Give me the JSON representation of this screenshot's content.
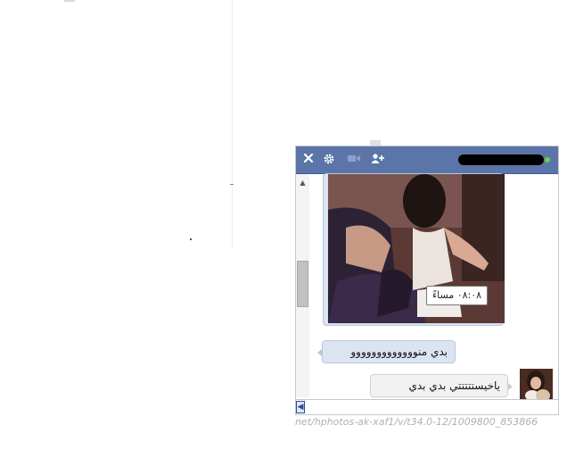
{
  "chat": {
    "icons": {
      "close": "close-icon",
      "settings": "gear-icon",
      "video": "video-camera-icon",
      "add_friend": "add-friend-icon"
    },
    "photo_timestamp": "٠٨:٠٨ مساءً",
    "messages": [
      {
        "text": "بدي منووووووووووووو",
        "side": "in"
      },
      {
        "text": "ياخيستتتتتي بدي بدي",
        "side": "out"
      }
    ],
    "colors": {
      "header": "#5c75a9",
      "incoming_bubble": "#dbe4f1",
      "outgoing_bubble": "#f2f2f2",
      "online": "#6fcf3a"
    }
  },
  "status_bar": {
    "url": "net/hphotos-ak-xaf1/v/t34.0-12/1009800_853866"
  }
}
